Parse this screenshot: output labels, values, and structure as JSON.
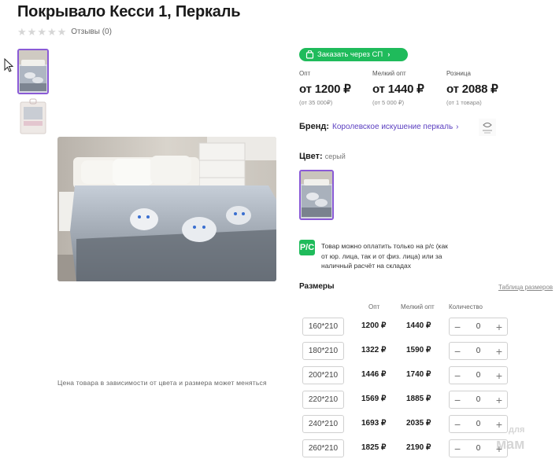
{
  "product": {
    "title": "Покрывало Кесси 1, Перкаль",
    "reviews_label": "Отзывы (0)",
    "rating_stars": 0
  },
  "order_button": {
    "label": "Заказать через СП"
  },
  "prices": [
    {
      "label": "Опт",
      "value": "от 1200 ₽",
      "note": "(от 35 000₽)"
    },
    {
      "label": "Мелкий опт",
      "value": "от 1440 ₽",
      "note": "(от 5 000 ₽)"
    },
    {
      "label": "Розница",
      "value": "от 2088 ₽",
      "note": "(от 1 товара)"
    }
  ],
  "brand": {
    "label": "Бренд:",
    "value": "Королевское искушение перкаль"
  },
  "color": {
    "label": "Цвет:",
    "value": "серый"
  },
  "payment": {
    "icon_text": "Р/С",
    "note": "Товар можно оплатить только на р/с (как от юр. лица, так и от физ. лица) или за наличный расчёт на складах"
  },
  "price_note": "Цена товара в зависимости от цвета и размера может меняться",
  "sizes": {
    "title": "Размеры",
    "table_link": "Таблица размеров",
    "headers": {
      "opt": "Опт",
      "small": "Мелкий опт",
      "qty": "Количество"
    },
    "rows": [
      {
        "size": "160*210",
        "opt": "1200 ₽",
        "small": "1440 ₽",
        "qty": "0"
      },
      {
        "size": "180*210",
        "opt": "1322 ₽",
        "small": "1590 ₽",
        "qty": "0"
      },
      {
        "size": "200*210",
        "opt": "1446 ₽",
        "small": "1740 ₽",
        "qty": "0"
      },
      {
        "size": "220*210",
        "opt": "1569 ₽",
        "small": "1885 ₽",
        "qty": "0"
      },
      {
        "size": "240*210",
        "opt": "1693 ₽",
        "small": "2035 ₽",
        "qty": "0"
      },
      {
        "size": "260*210",
        "opt": "1825 ₽",
        "small": "2190 ₽",
        "qty": "0"
      }
    ]
  },
  "watermark": {
    "line1": "для",
    "line2": "мам"
  },
  "colors": {
    "accent": "#8a5ad6",
    "green": "#1fbb5b",
    "link": "#5b3fc0"
  }
}
